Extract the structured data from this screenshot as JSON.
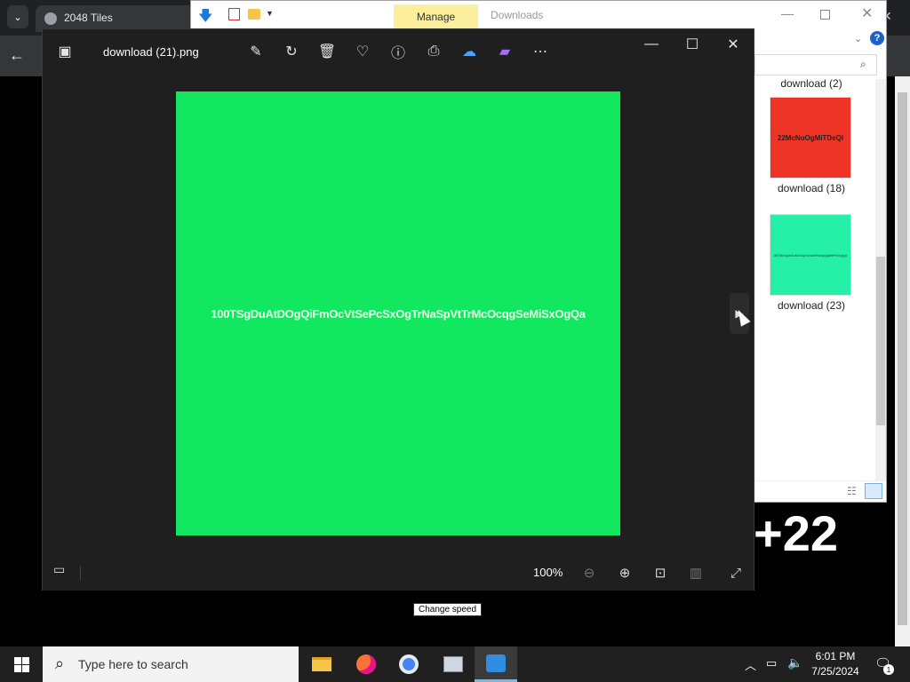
{
  "browser": {
    "tab_title": "2048 Tiles",
    "score_text": "+22",
    "change_speed_label": "Change speed"
  },
  "explorer": {
    "manage_tab": "Manage",
    "title": "Downloads",
    "help_label": "?",
    "files": [
      {
        "name": "download (2)",
        "thumb_color": "",
        "thumb_text": ""
      },
      {
        "name": "download (18)",
        "thumb_color": "#ee3427",
        "thumb_text": "22McNoOgMiTDeQl"
      },
      {
        "name": "download (23)",
        "thumb_color": "#24f0a8",
        "thumb_text": "46TWnQaOuNcOqXvIsbiHsIqsQaIHPvGqQo"
      }
    ]
  },
  "photos": {
    "filename": "download (21).png",
    "image_color": "#11e860",
    "image_text": "100TSgDuAtDOgQiFmOcVtSePcSxOgTrNaSpVtTrMcOcqgSeMiSxOgQa",
    "zoom_level": "100%",
    "toolbar_icons": [
      "edit-icon",
      "rotate-icon",
      "delete-icon",
      "favorite-icon",
      "info-icon",
      "print-icon",
      "onedrive-icon",
      "clipchamp-icon",
      "more-icon"
    ],
    "next_label": "▶"
  },
  "taskbar": {
    "search_placeholder": "Type here to search",
    "time": "6:01 PM",
    "date": "7/25/2024",
    "notification_count": "1",
    "accent": "#76b9ed"
  }
}
